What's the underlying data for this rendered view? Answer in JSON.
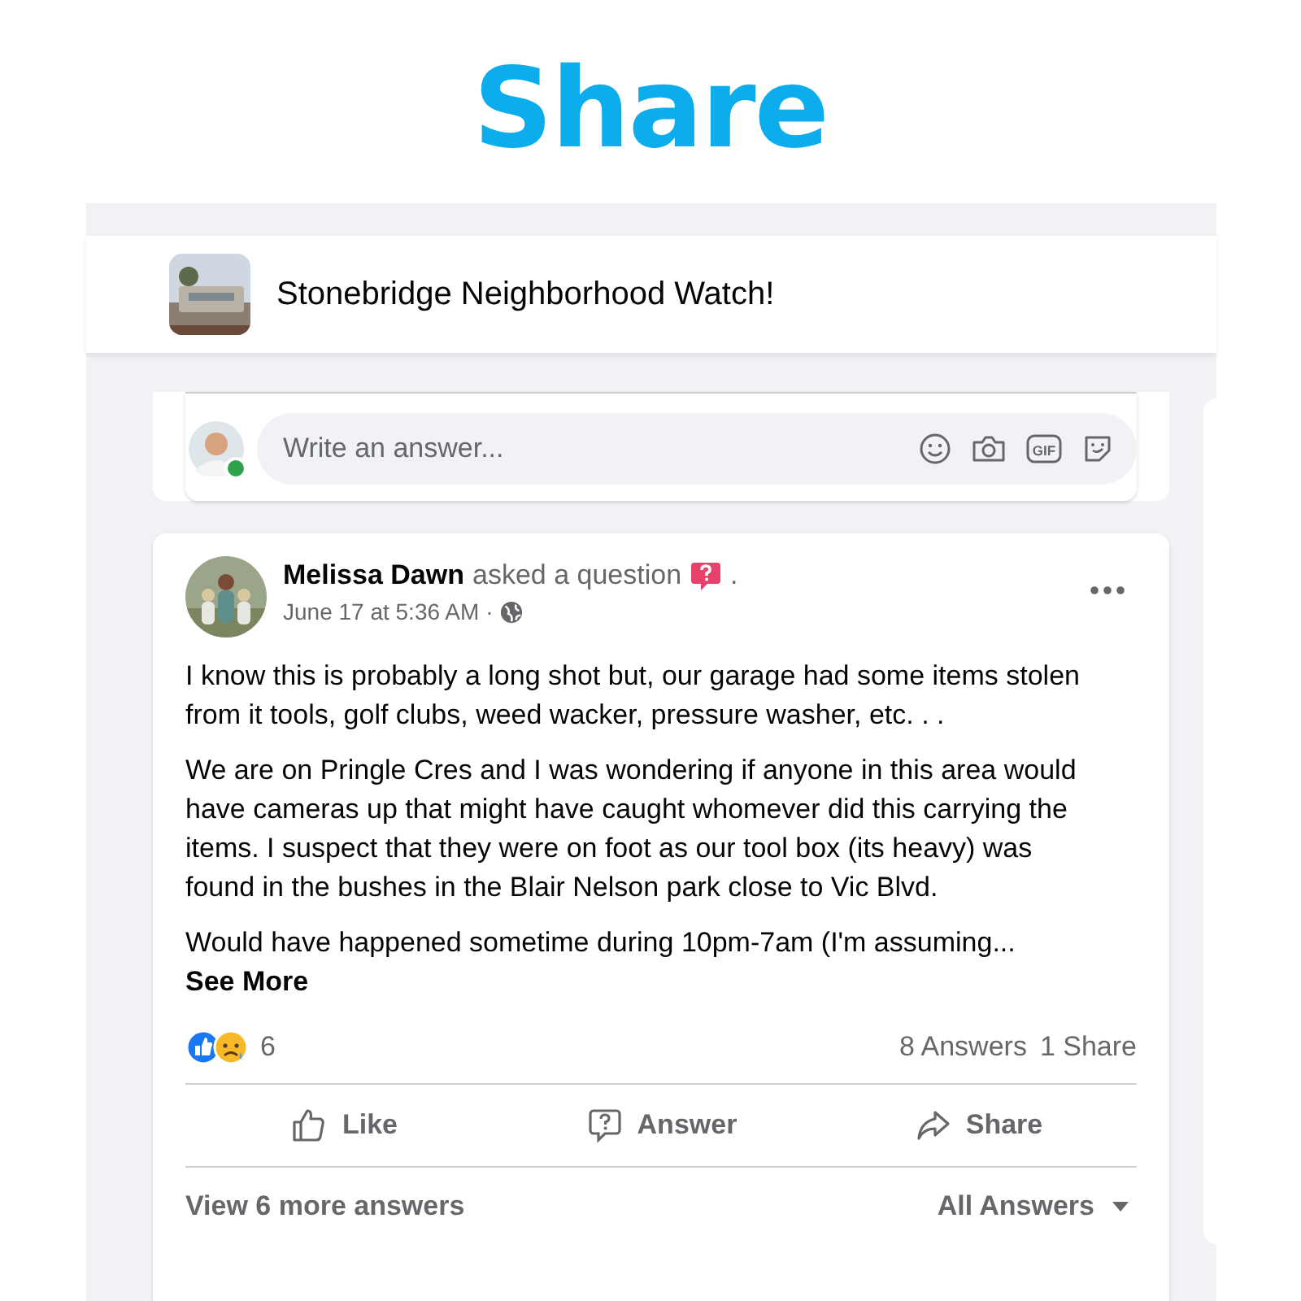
{
  "title": "Share",
  "group": {
    "name": "Stonebridge Neighborhood Watch!"
  },
  "composer": {
    "placeholder": "Write an answer...",
    "online": true,
    "gif_label": "GIF"
  },
  "post": {
    "author": "Melissa Dawn",
    "action": "asked a question",
    "trailer": ".",
    "time": "June 17 at 5:36 AM",
    "time_separator": "·",
    "paragraphs": [
      "I know this is probably a long shot but, our garage had some items stolen from it tools, golf clubs, weed wacker, pressure washer, etc. . .",
      "We are on Pringle Cres and I was wondering if anyone in this area would have cameras up that might have caught whomever did this carrying the items. I suspect that they were on foot as our tool box (its heavy) was found in the bushes in the Blair Nelson park close to Vic Blvd.",
      "Would have happened sometime during 10pm-7am (I'm assuming..."
    ],
    "see_more": "See More",
    "reaction_count": "6",
    "answers": "8 Answers",
    "shares": "1 Share",
    "actions": [
      {
        "label": "Like",
        "kind": "like"
      },
      {
        "label": "Answer",
        "kind": "answer"
      },
      {
        "label": "Share",
        "kind": "share"
      }
    ],
    "view_more": "View 6 more answers",
    "sort": "All Answers"
  }
}
